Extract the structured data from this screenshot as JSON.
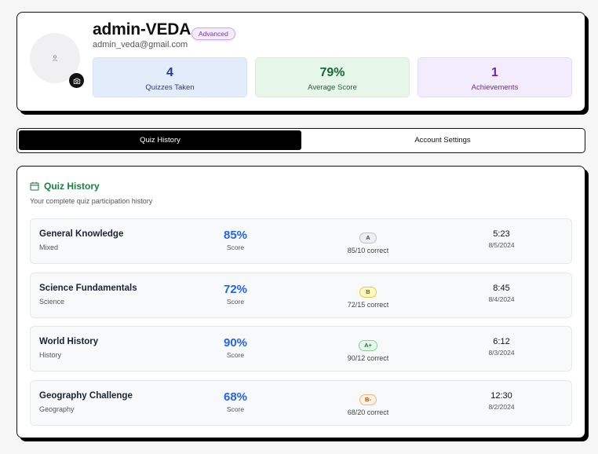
{
  "profile": {
    "username": "admin-VEDA",
    "level_badge": "Advanced",
    "email": "admin_veda@gmail.com",
    "stats": [
      {
        "value": "4",
        "label": "Quizzes Taken"
      },
      {
        "value": "79%",
        "label": "Average Score"
      },
      {
        "value": "1",
        "label": "Achievements"
      }
    ]
  },
  "tabs": [
    {
      "label": "Quiz History",
      "active": true
    },
    {
      "label": "Account Settings",
      "active": false
    }
  ],
  "history": {
    "title": "Quiz History",
    "subtitle": "Your complete quiz participation history",
    "score_label": "Score",
    "items": [
      {
        "name": "General Knowledge",
        "category": "Mixed",
        "score": "85%",
        "grade": "A",
        "correct": "85/10 correct",
        "time": "5:23",
        "date": "8/5/2024"
      },
      {
        "name": "Science Fundamentals",
        "category": "Science",
        "score": "72%",
        "grade": "B",
        "correct": "72/15 correct",
        "time": "8:45",
        "date": "8/4/2024"
      },
      {
        "name": "World History",
        "category": "History",
        "score": "90%",
        "grade": "A+",
        "correct": "90/12 correct",
        "time": "6:12",
        "date": "8/3/2024"
      },
      {
        "name": "Geography Challenge",
        "category": "Geography",
        "score": "68%",
        "grade": "B-",
        "correct": "68/20 correct",
        "time": "12:30",
        "date": "8/2/2024"
      }
    ]
  }
}
